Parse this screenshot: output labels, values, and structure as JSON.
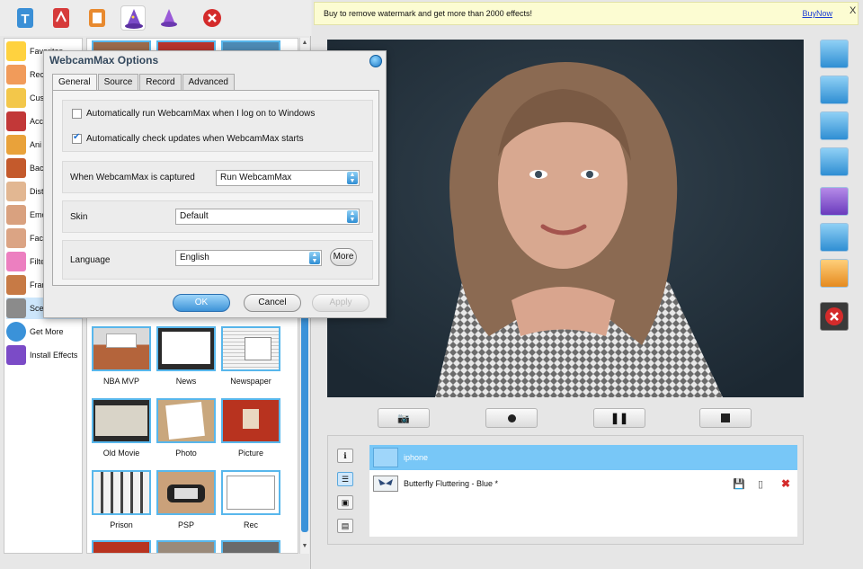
{
  "categories": [
    {
      "label": "Favorites",
      "icon": "star-icon"
    },
    {
      "label": "Rec",
      "icon": "record-icon"
    },
    {
      "label": "Cus",
      "icon": "folder-icon"
    },
    {
      "label": "Acc",
      "icon": "hat-icon"
    },
    {
      "label": "Ani",
      "icon": "butterfly-icon"
    },
    {
      "label": "Bac",
      "icon": "background-icon"
    },
    {
      "label": "Dist",
      "icon": "face-distort-icon"
    },
    {
      "label": "Emo",
      "icon": "emotion-icon"
    },
    {
      "label": "Fac",
      "icon": "face-icon"
    },
    {
      "label": "Filte",
      "icon": "filter-icon"
    },
    {
      "label": "Fran",
      "icon": "frame-icon"
    },
    {
      "label": "Sce",
      "icon": "scene-icon"
    },
    {
      "label": "Get More",
      "icon": "globe-icon"
    },
    {
      "label": "Install Effects",
      "icon": "install-wizard-icon"
    }
  ],
  "effects": [
    {
      "label": "NBA MVP"
    },
    {
      "label": "News"
    },
    {
      "label": "Newspaper"
    },
    {
      "label": "Old Movie"
    },
    {
      "label": "Photo"
    },
    {
      "label": "Picture"
    },
    {
      "label": "Prison"
    },
    {
      "label": "PSP"
    },
    {
      "label": "Rec"
    }
  ],
  "banner": {
    "text": "Buy to remove watermark and get more than 2000 effects!",
    "link": "BuyNow",
    "close": "X"
  },
  "dialog": {
    "title": "WebcamMax Options",
    "tabs": [
      "General",
      "Source",
      "Record",
      "Advanced"
    ],
    "auto_run_label": "Automatically run WebcamMax when I log on to Windows",
    "auto_run_checked": false,
    "auto_update_label": "Automatically check updates when WebcamMax starts",
    "auto_update_checked": true,
    "captured_label": "When WebcamMax is captured",
    "captured_value": "Run WebcamMax",
    "skin_label": "Skin",
    "skin_value": "Default",
    "language_label": "Language",
    "language_value": "English",
    "more_label": "More",
    "ok_label": "OK",
    "cancel_label": "Cancel",
    "apply_label": "Apply"
  },
  "layers": [
    {
      "label": "iphone",
      "selected": true
    },
    {
      "label": "Butterfly Fluttering - Blue *",
      "selected": false
    }
  ],
  "colors": {
    "accent": "#3a92d9",
    "selection": "#78c7f7",
    "banner": "#fcfcd2"
  }
}
